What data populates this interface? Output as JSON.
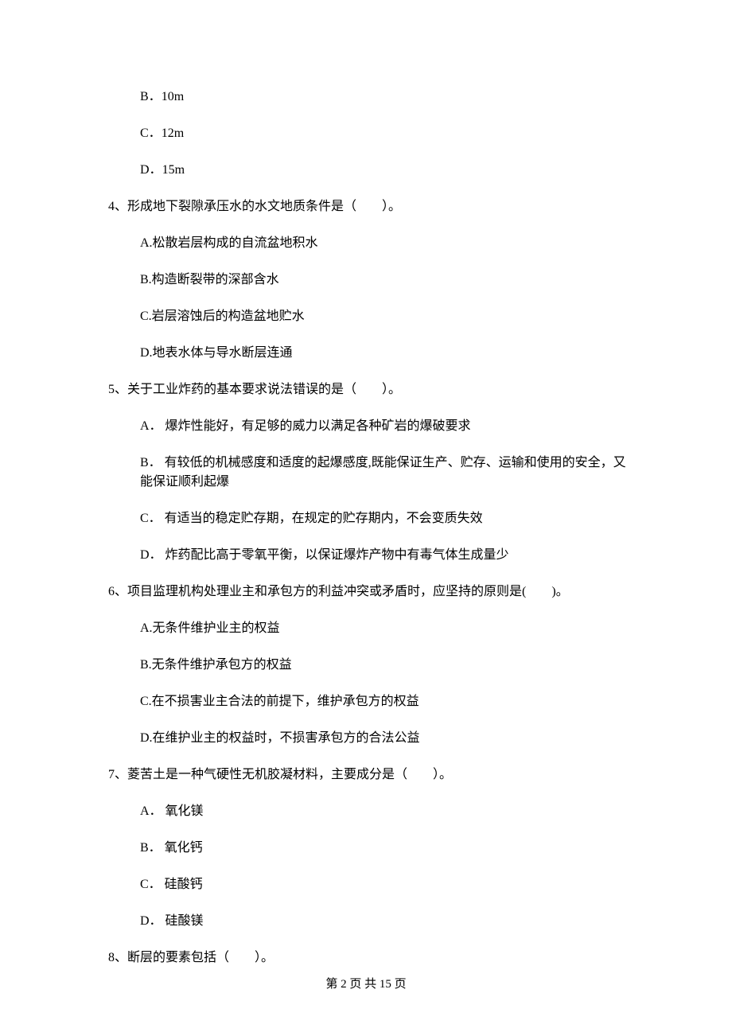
{
  "options_q3_partial": [
    {
      "label": "B．",
      "text": "10m"
    },
    {
      "label": "C．",
      "text": "12m"
    },
    {
      "label": "D．",
      "text": "15m"
    }
  ],
  "q4": {
    "stem": "4、形成地下裂隙承压水的水文地质条件是（　　）。",
    "options": [
      "A.松散岩层构成的自流盆地积水",
      "B.构造断裂带的深部含水",
      "C.岩层溶蚀后的构造盆地贮水",
      "D.地表水体与导水断层连通"
    ]
  },
  "q5": {
    "stem": "5、关于工业炸药的基本要求说法错误的是（　　）。",
    "options": [
      "A． 爆炸性能好，有足够的威力以满足各种矿岩的爆破要求",
      "B． 有较低的机械感度和适度的起爆感度,既能保证生产、贮存、运输和使用的安全，又能保证顺利起爆",
      "C． 有适当的稳定贮存期，在规定的贮存期内，不会变质失效",
      "D． 炸药配比高于零氧平衡，以保证爆炸产物中有毒气体生成量少"
    ]
  },
  "q6": {
    "stem": "6、项目监理机构处理业主和承包方的利益冲突或矛盾时，应坚持的原则是(　　)。",
    "options": [
      "A.无条件维护业主的权益",
      "B.无条件维护承包方的权益",
      "C.在不损害业主合法的前提下，维护承包方的权益",
      "D.在维护业主的权益时，不损害承包方的合法公益"
    ]
  },
  "q7": {
    "stem": "7、菱苦土是一种气硬性无机胶凝材料，主要成分是（　　）。",
    "options": [
      "A． 氧化镁",
      "B． 氧化钙",
      "C． 硅酸钙",
      "D． 硅酸镁"
    ]
  },
  "q8": {
    "stem": "8、断层的要素包括（　　）。"
  },
  "footer": "第 2 页 共 15 页"
}
